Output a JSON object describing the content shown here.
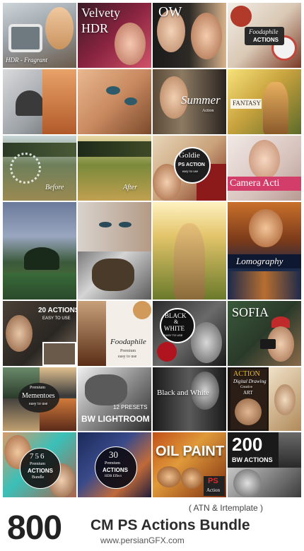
{
  "tiles": {
    "hdr_fragrant": "HDR - Fragrant",
    "velvety": "Velvety",
    "hdr": "HDR",
    "ow": "OW",
    "foodaphile_top": "Foodaphile",
    "actions_top": "ACTIONS",
    "summer": "Summer",
    "summer_sub": "Action",
    "fantasy": "FANTASY",
    "before": "Before",
    "after": "After",
    "goldie": "Goldie",
    "goldie_ps": "PS ACTION",
    "goldie_sub": "easy to use",
    "camera_actions": "Camera Acti",
    "lomography": "Lomography",
    "actions_20": "20 ACTIONS",
    "actions_20_sub": "EASY TO USE",
    "foodaphile": "Foodaphile",
    "foodaphile_sub1": "Premium",
    "foodaphile_sub2": "easy to use",
    "black": "BLACK",
    "and": "&",
    "white": "WHITE",
    "bw_sub": "EASY TO USE",
    "sofia": "SOFIA",
    "mementoes_pre": "Premium",
    "mementoes": "Mementoes",
    "mementoes_sub": "easy to use",
    "black_and_white": "Black and White",
    "presets_12": "12 PRESETS",
    "bw_lightroom": "BW LIGHTROOM",
    "action": "ACTION",
    "digital_drawing": "Digital Drawing",
    "creative": "Creative",
    "art": "ART",
    "n756": "756",
    "premium_756": "Premium",
    "actions_756": "ACTIONS",
    "bundle_756": "Bundle",
    "n30": "30",
    "premium_30": "Premium",
    "actions_30": "ACTIONS",
    "sub_30": "HDR Effect",
    "oil_paint": "OIL PAINT",
    "ps": "PS",
    "ps_action": "Action",
    "n200": "200",
    "bw_actions": "BW ACTIONS"
  },
  "footer": {
    "count": "800",
    "title": "CM PS Actions Bundle",
    "site": "www.persianGFX.com",
    "formats": "( ATN & Irtemplate )"
  },
  "colors": {
    "accent_red": "#c1121f",
    "text_dark": "#2c2c2c"
  }
}
